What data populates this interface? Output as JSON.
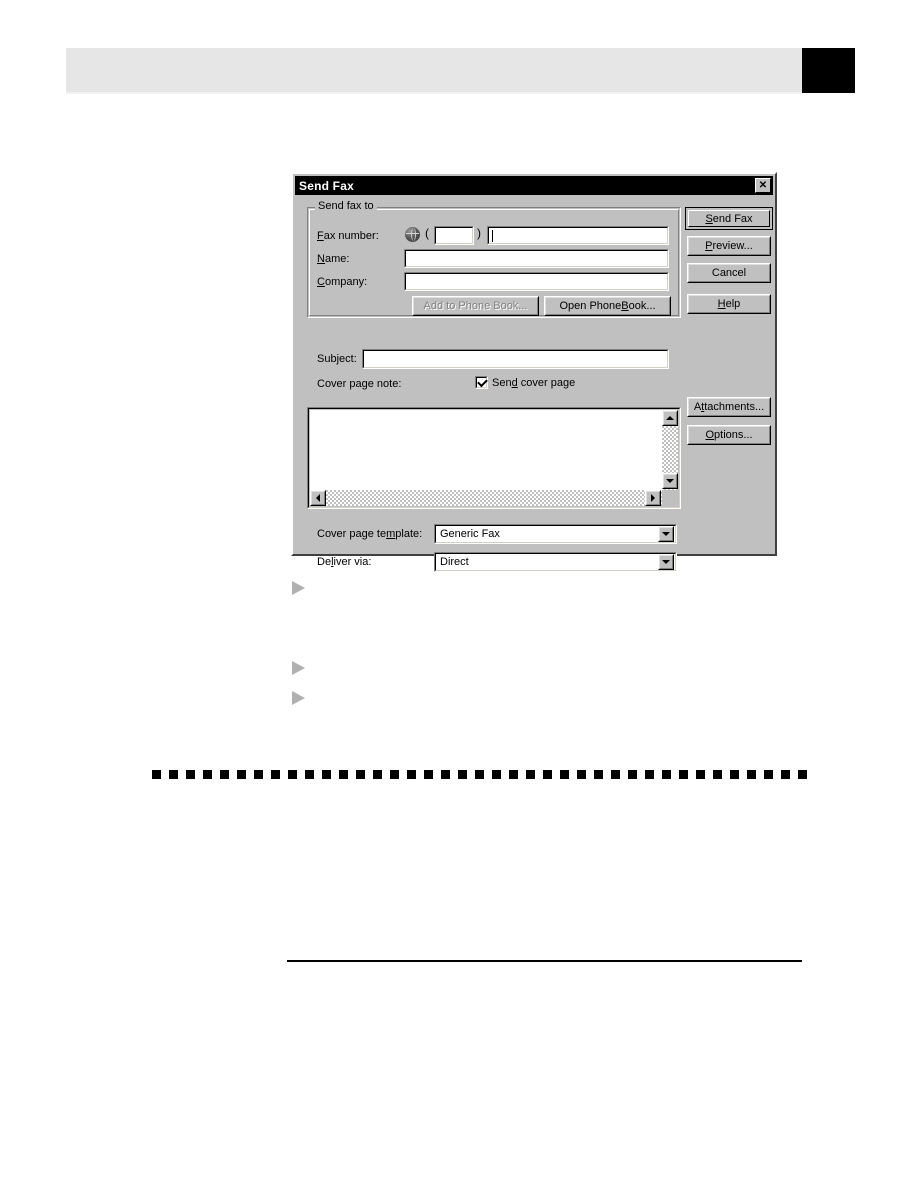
{
  "page": {
    "header_bar": "",
    "header_tab": "",
    "bullets": [
      {
        "text": ""
      },
      {
        "text": ""
      },
      {
        "text": ""
      }
    ],
    "footer_note": ""
  },
  "dialog": {
    "title": "Send Fax",
    "close_label": "✕",
    "group": {
      "title": "Send fax to",
      "fax_number_label": "Fax number:",
      "fax_number_label_accel": "F",
      "globe_icon": "globe-icon",
      "paren_open": "(",
      "paren_close": ")",
      "area_code_value": "",
      "fax_number_value": "",
      "name_label": "Name:",
      "name_value": "",
      "company_label": "Company:",
      "company_value": "",
      "add_to_phone_book_label": "Add to Phone Book...",
      "open_phone_book_label": "Open Phone Book..."
    },
    "subject_label": "Subject:",
    "subject_value": "",
    "cover_page_note_label": "Cover page note:",
    "send_cover_page_label": "Send cover page",
    "send_cover_page_checked": true,
    "cover_page_note_value": "",
    "cover_page_template_label": "Cover page template:",
    "cover_page_template_value": "Generic Fax",
    "deliver_via_label": "Deliver via:",
    "deliver_via_value": "Direct",
    "buttons": {
      "send_fax": "Send Fax",
      "preview": "Preview...",
      "cancel": "Cancel",
      "help": "Help",
      "attachments": "Attachments...",
      "options": "Options..."
    },
    "scroll": {
      "up_arrow": "scroll-up-icon",
      "down_arrow": "scroll-down-icon",
      "left_arrow": "scroll-left-icon",
      "right_arrow": "scroll-right-icon"
    },
    "colors": {
      "face": "#c0c0c0",
      "titlebar": "#000000",
      "titlebar_text": "#ffffff",
      "field": "#ffffff",
      "shadow": "#808080",
      "highlight": "#ffffff",
      "disabled_text": "#808080"
    }
  }
}
